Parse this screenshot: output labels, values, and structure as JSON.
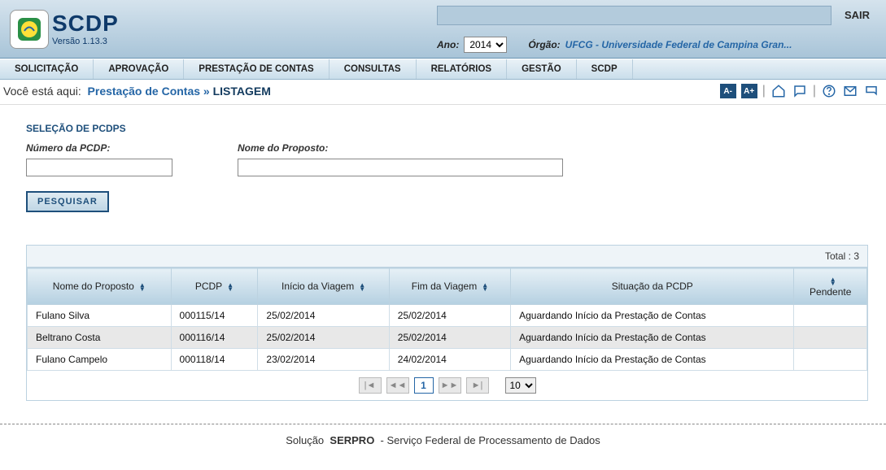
{
  "header": {
    "app_abbrev": "SCDP",
    "version": "Versão 1.13.3",
    "sair": "SAIR",
    "ano_label": "Ano:",
    "ano_value": "2014",
    "orgao_label": "Órgão:",
    "orgao_link": "UFCG - Universidade Federal de Campina Gran..."
  },
  "menu": {
    "solicitacao": "SOLICITAÇÃO",
    "aprovacao": "APROVAÇÃO",
    "prestacao": "PRESTAÇÃO DE CONTAS",
    "consultas": "CONSULTAS",
    "relatorios": "RELATÓRIOS",
    "gestao": "GESTÃO",
    "scdp": "SCDP"
  },
  "breadcrumb": {
    "you_are_here": "Você está aqui:",
    "link1": "Prestação de Contas",
    "current": "LISTAGEM"
  },
  "toolbar": {
    "a_minus": "A-",
    "a_plus": "A+"
  },
  "filters": {
    "section": "SELEÇÃO DE PCDPS",
    "pcdp_label": "Número da PCDP:",
    "nome_label": "Nome do Proposto:",
    "search_btn": "PESQUISAR"
  },
  "table": {
    "total_label": "Total :",
    "total_value": "3",
    "col_nome": "Nome do Proposto",
    "col_pcdp": "PCDP",
    "col_inicio": "Início da Viagem",
    "col_fim": "Fim da Viagem",
    "col_situacao": "Situação da PCDP",
    "col_pendente": "Pendente",
    "rows": [
      {
        "nome": "Fulano Silva",
        "pcdp": "000115/14",
        "inicio": "25/02/2014",
        "fim": "25/02/2014",
        "sit": "Aguardando Início da Prestação de Contas",
        "pend": ""
      },
      {
        "nome": "Beltrano Costa",
        "pcdp": "000116/14",
        "inicio": "25/02/2014",
        "fim": "25/02/2014",
        "sit": "Aguardando Início da Prestação de Contas",
        "pend": ""
      },
      {
        "nome": "Fulano Campelo",
        "pcdp": "000118/14",
        "inicio": "23/02/2014",
        "fim": "24/02/2014",
        "sit": "Aguardando Início da Prestação de Contas",
        "pend": ""
      }
    ]
  },
  "pager": {
    "page": "1",
    "size": "10"
  },
  "footer": {
    "pre": "Solução",
    "brand": "SERPRO",
    "post": "- Serviço Federal de Processamento de Dados"
  }
}
